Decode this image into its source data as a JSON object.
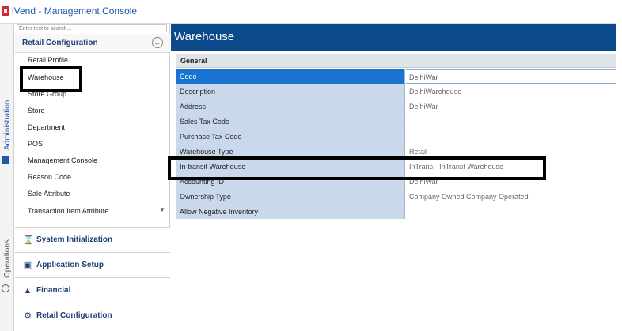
{
  "window": {
    "title": "iVend - Management Console"
  },
  "side_tabs": [
    {
      "label": "Administration",
      "icon": "admin-icon"
    },
    {
      "label": "Operations",
      "icon": "gear-icon"
    }
  ],
  "nav": {
    "search_placeholder": "Enter text to search...",
    "header_title": "Retail Configuration",
    "back_icon": "back-arrow-icon",
    "items": [
      "Retail Profile",
      "Warehouse",
      "Store Group",
      "Store",
      "Department",
      "POS",
      "Management Console",
      "Reason Code",
      "Sale Attribute",
      "Transaction Item Attribute"
    ],
    "scroll_icon": "chevron-down-icon",
    "sections": [
      {
        "label": "System Initialization",
        "icon": "hourglass-icon"
      },
      {
        "label": "Application Setup",
        "icon": "window-icon"
      },
      {
        "label": "Financial",
        "icon": "bank-icon"
      },
      {
        "label": "Retail Configuration",
        "icon": "gears-icon"
      }
    ]
  },
  "main": {
    "title": "Warehouse",
    "group": "General",
    "rows": [
      {
        "name": "Code",
        "value": "DelhiWar",
        "selected": true
      },
      {
        "name": "Description",
        "value": "DelhiWarehouse"
      },
      {
        "name": "Address",
        "value": "DelhiWar"
      },
      {
        "name": "Sales Tax Code",
        "value": ""
      },
      {
        "name": "Purchase Tax Code",
        "value": ""
      },
      {
        "name": "Warehouse Type",
        "value": "Retail"
      },
      {
        "name": "In-transit Warehouse",
        "value": "InTrans - InTranst Warehouse"
      },
      {
        "name": "Accounting ID",
        "value": "DelhiWar"
      },
      {
        "name": "Ownership Type",
        "value": "Company Owned Company Operated"
      },
      {
        "name": "Allow Negative Inventory",
        "value": "",
        "checkbox": true
      }
    ]
  },
  "colors": {
    "header_blue": "#0d4a8c",
    "selected_row": "#1a73d0",
    "property_name_bg": "#c9d8ea",
    "title_blue": "#1e5aa8"
  }
}
